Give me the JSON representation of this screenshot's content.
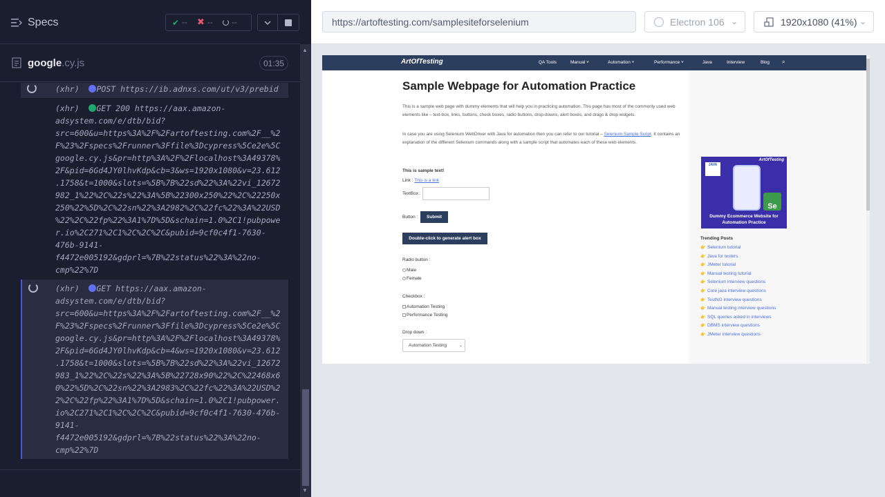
{
  "sidebar": {
    "specs_label": "Specs",
    "stats": {
      "passed": "--",
      "failed": "--",
      "pending": "--"
    },
    "file": {
      "name": "google",
      "ext": ".cy.js",
      "duration": "01:35"
    }
  },
  "log": {
    "entry1": "(xhr)  ●POST https://ib.adnxs.com/ut/v3/prebid",
    "entry2": "(xhr)  ●GET 200 https://aax.amazon-\nadsystem.com/e/dtb/bid?\nsrc=600&u=https%3A%2F%2Fartoftesting.com%2F__%2\nF%23%2Fspecs%2Frunner%3Ffile%3Dcypress%5Ce2e%5C\ngoogle.cy.js&pr=http%3A%2F%2Flocalhost%3A49378%\n2F&pid=6Gd4JY0lhvKdp&cb=3&ws=1920x1080&v=23.612\n.1758&t=1000&slots=%5B%7B%22sd%22%3A%22vi_12672\n982_1%22%2C%22s%22%3A%5B%22300x250%22%2C%22250x\n250%22%5D%2C%22sn%22%3A2982%2C%22fc%22%3A%22USD\n%22%2C%22fp%22%3A1%7D%5D&schain=1.0%2C1!pubpowe\nr.io%2C271%2C1%2C%2C%2C&pubid=9cf0c4f1-7630-\n476b-9141-\nf4472e005192&gdprl=%7B%22status%22%3A%22no-\ncmp%22%7D",
    "entry3": "(xhr)  ●GET https://aax.amazon-\nadsystem.com/e/dtb/bid?\nsrc=600&u=https%3A%2F%2Fartoftesting.com%2F__%2\nF%23%2Fspecs%2Frunner%3Ffile%3Dcypress%5Ce2e%5C\ngoogle.cy.js&pr=http%3A%2F%2Flocalhost%3A49378%\n2F&pid=6Gd4JY0lhvKdp&cb=4&ws=1920x1080&v=23.612\n.1758&t=1000&slots=%5B%7B%22sd%22%3A%22vi_12672\n983_1%22%2C%22s%22%3A%5B%22728x90%22%2C%22468x6\n0%22%5D%2C%22sn%22%3A2983%2C%22fc%22%3A%22USD%2\n2%2C%22fp%22%3A1%7D%5D&schain=1.0%2C1!pubpower.\nio%2C271%2C1%2C%2C%2C&pubid=9cf0c4f1-7630-476b-\n9141-\nf4472e005192&gdprl=%7B%22status%22%3A%22no-\ncmp%22%7D"
  },
  "toolbar": {
    "url": "https://artoftesting.com/samplesiteforselenium",
    "browser": "Electron 106",
    "viewport": "1920x1080  (41%)"
  },
  "aut": {
    "logo": "ArtOfTesting",
    "nav": [
      "QA Tools",
      "Manual ˅",
      "Automation ˅",
      "Performance ˅",
      "Java",
      "Interview",
      "Blog"
    ],
    "title": "Sample Webpage for Automation Practice",
    "para1": "This is a sample web page with dummy elements that will help you in practicing automation. This page has most of the commonly used web elements like – text-box, links, buttons, check boxes, radio buttons, drop-downs, alert boxes, and drags & drop widgets.",
    "para2_pre": "In case you are using Selenium WebDriver with Java for automation then you can refer to our tutorial – ",
    "para2_link": "Selenium Sample Script",
    "para2_post": ". It contains an explanation of the different Selenium commands along with a sample script that automates each of these web elements.",
    "sample_text": "This is sample text!",
    "link_label": "Link : ",
    "link_text": "This is a link",
    "textbox_label": "TextBox :",
    "button_label": "Button :",
    "submit": "Submit",
    "dblclick": "Double-click to generate alert box",
    "radio_label": "Radio button :",
    "radio1": "Male",
    "radio2": "Female",
    "checkbox_label": "Checkbox :",
    "check1": "Automation Testing",
    "check2": "Performance Testing",
    "dropdown_label": "Drop down :",
    "dropdown_value": "Automation Testing",
    "promo_title": "Dummy Ecommerce Website for Automation Practice",
    "promo_logo": "ArtOfTesting",
    "promo_java": "JAVA",
    "promo_se": "Se",
    "trending_title": "Trending Posts",
    "trending": [
      "Selenium tutorial",
      "Java for testers",
      "JMeter tutorial",
      "Manual testing tutorial",
      "Selenium interview questions",
      "Core java interview questions",
      "TestNG interview questions",
      "Manual testing interview questions",
      "SQL queries asked in interviews",
      "DBMS interview questions",
      "JMeter interview questions"
    ]
  },
  "colors": {
    "accent": "#4956e3",
    "pass": "#1fa971",
    "fail": "#e45770",
    "post_dot": "#6470f3",
    "get200_dot": "#1fa971",
    "nav_bg": "#2c3e5e"
  }
}
